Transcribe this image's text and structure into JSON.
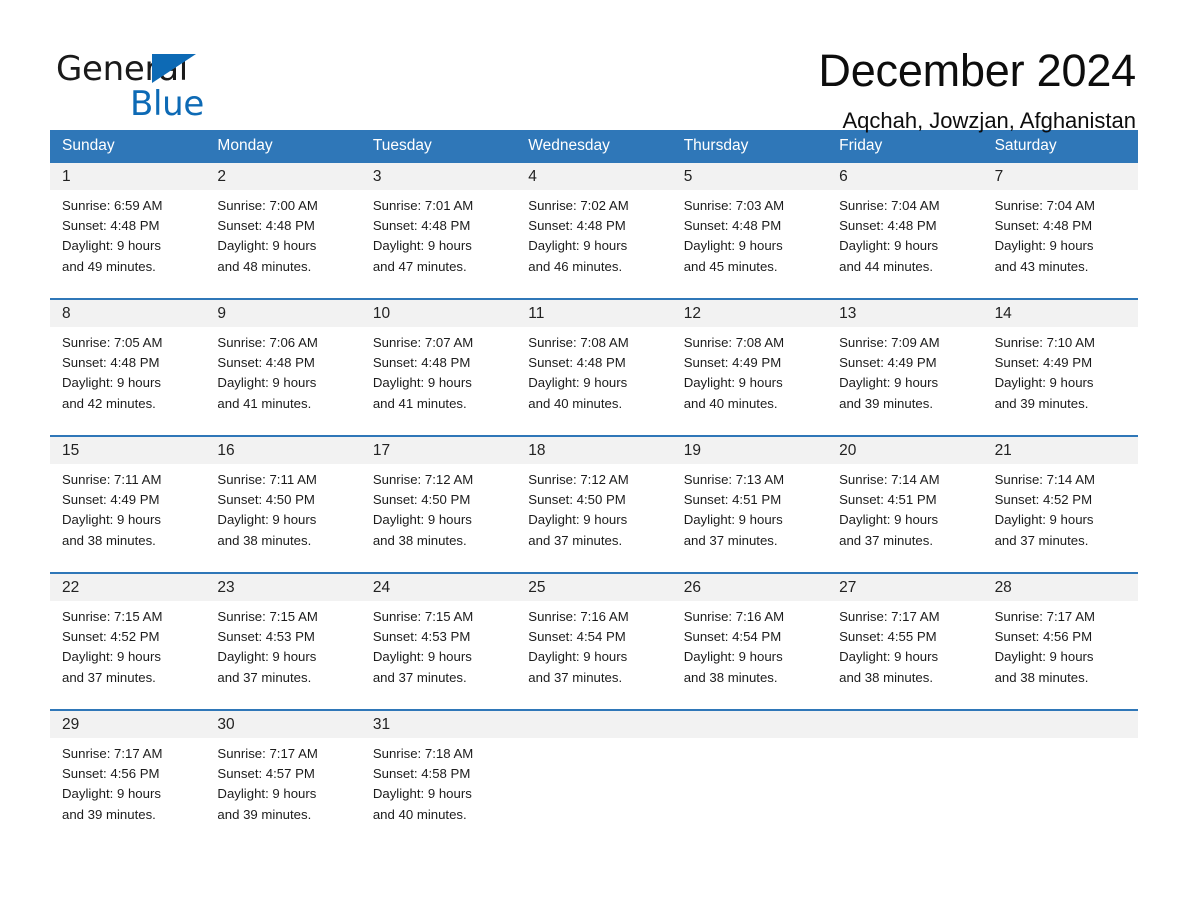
{
  "brand": {
    "name_part1": "General",
    "name_part2": "Blue",
    "accent_color": "#0d6ab5"
  },
  "header": {
    "title": "December 2024",
    "subtitle": "Aqchah, Jowzjan, Afghanistan"
  },
  "calendar": {
    "header_bg_color": "#2f77b8",
    "daynum_bg_color": "#f2f2f2",
    "weekdays": [
      "Sunday",
      "Monday",
      "Tuesday",
      "Wednesday",
      "Thursday",
      "Friday",
      "Saturday"
    ],
    "weeks": [
      {
        "days": [
          {
            "num": "1",
            "sunrise": "Sunrise: 6:59 AM",
            "sunset": "Sunset: 4:48 PM",
            "daylight1": "Daylight: 9 hours",
            "daylight2": "and 49 minutes."
          },
          {
            "num": "2",
            "sunrise": "Sunrise: 7:00 AM",
            "sunset": "Sunset: 4:48 PM",
            "daylight1": "Daylight: 9 hours",
            "daylight2": "and 48 minutes."
          },
          {
            "num": "3",
            "sunrise": "Sunrise: 7:01 AM",
            "sunset": "Sunset: 4:48 PM",
            "daylight1": "Daylight: 9 hours",
            "daylight2": "and 47 minutes."
          },
          {
            "num": "4",
            "sunrise": "Sunrise: 7:02 AM",
            "sunset": "Sunset: 4:48 PM",
            "daylight1": "Daylight: 9 hours",
            "daylight2": "and 46 minutes."
          },
          {
            "num": "5",
            "sunrise": "Sunrise: 7:03 AM",
            "sunset": "Sunset: 4:48 PM",
            "daylight1": "Daylight: 9 hours",
            "daylight2": "and 45 minutes."
          },
          {
            "num": "6",
            "sunrise": "Sunrise: 7:04 AM",
            "sunset": "Sunset: 4:48 PM",
            "daylight1": "Daylight: 9 hours",
            "daylight2": "and 44 minutes."
          },
          {
            "num": "7",
            "sunrise": "Sunrise: 7:04 AM",
            "sunset": "Sunset: 4:48 PM",
            "daylight1": "Daylight: 9 hours",
            "daylight2": "and 43 minutes."
          }
        ]
      },
      {
        "days": [
          {
            "num": "8",
            "sunrise": "Sunrise: 7:05 AM",
            "sunset": "Sunset: 4:48 PM",
            "daylight1": "Daylight: 9 hours",
            "daylight2": "and 42 minutes."
          },
          {
            "num": "9",
            "sunrise": "Sunrise: 7:06 AM",
            "sunset": "Sunset: 4:48 PM",
            "daylight1": "Daylight: 9 hours",
            "daylight2": "and 41 minutes."
          },
          {
            "num": "10",
            "sunrise": "Sunrise: 7:07 AM",
            "sunset": "Sunset: 4:48 PM",
            "daylight1": "Daylight: 9 hours",
            "daylight2": "and 41 minutes."
          },
          {
            "num": "11",
            "sunrise": "Sunrise: 7:08 AM",
            "sunset": "Sunset: 4:48 PM",
            "daylight1": "Daylight: 9 hours",
            "daylight2": "and 40 minutes."
          },
          {
            "num": "12",
            "sunrise": "Sunrise: 7:08 AM",
            "sunset": "Sunset: 4:49 PM",
            "daylight1": "Daylight: 9 hours",
            "daylight2": "and 40 minutes."
          },
          {
            "num": "13",
            "sunrise": "Sunrise: 7:09 AM",
            "sunset": "Sunset: 4:49 PM",
            "daylight1": "Daylight: 9 hours",
            "daylight2": "and 39 minutes."
          },
          {
            "num": "14",
            "sunrise": "Sunrise: 7:10 AM",
            "sunset": "Sunset: 4:49 PM",
            "daylight1": "Daylight: 9 hours",
            "daylight2": "and 39 minutes."
          }
        ]
      },
      {
        "days": [
          {
            "num": "15",
            "sunrise": "Sunrise: 7:11 AM",
            "sunset": "Sunset: 4:49 PM",
            "daylight1": "Daylight: 9 hours",
            "daylight2": "and 38 minutes."
          },
          {
            "num": "16",
            "sunrise": "Sunrise: 7:11 AM",
            "sunset": "Sunset: 4:50 PM",
            "daylight1": "Daylight: 9 hours",
            "daylight2": "and 38 minutes."
          },
          {
            "num": "17",
            "sunrise": "Sunrise: 7:12 AM",
            "sunset": "Sunset: 4:50 PM",
            "daylight1": "Daylight: 9 hours",
            "daylight2": "and 38 minutes."
          },
          {
            "num": "18",
            "sunrise": "Sunrise: 7:12 AM",
            "sunset": "Sunset: 4:50 PM",
            "daylight1": "Daylight: 9 hours",
            "daylight2": "and 37 minutes."
          },
          {
            "num": "19",
            "sunrise": "Sunrise: 7:13 AM",
            "sunset": "Sunset: 4:51 PM",
            "daylight1": "Daylight: 9 hours",
            "daylight2": "and 37 minutes."
          },
          {
            "num": "20",
            "sunrise": "Sunrise: 7:14 AM",
            "sunset": "Sunset: 4:51 PM",
            "daylight1": "Daylight: 9 hours",
            "daylight2": "and 37 minutes."
          },
          {
            "num": "21",
            "sunrise": "Sunrise: 7:14 AM",
            "sunset": "Sunset: 4:52 PM",
            "daylight1": "Daylight: 9 hours",
            "daylight2": "and 37 minutes."
          }
        ]
      },
      {
        "days": [
          {
            "num": "22",
            "sunrise": "Sunrise: 7:15 AM",
            "sunset": "Sunset: 4:52 PM",
            "daylight1": "Daylight: 9 hours",
            "daylight2": "and 37 minutes."
          },
          {
            "num": "23",
            "sunrise": "Sunrise: 7:15 AM",
            "sunset": "Sunset: 4:53 PM",
            "daylight1": "Daylight: 9 hours",
            "daylight2": "and 37 minutes."
          },
          {
            "num": "24",
            "sunrise": "Sunrise: 7:15 AM",
            "sunset": "Sunset: 4:53 PM",
            "daylight1": "Daylight: 9 hours",
            "daylight2": "and 37 minutes."
          },
          {
            "num": "25",
            "sunrise": "Sunrise: 7:16 AM",
            "sunset": "Sunset: 4:54 PM",
            "daylight1": "Daylight: 9 hours",
            "daylight2": "and 37 minutes."
          },
          {
            "num": "26",
            "sunrise": "Sunrise: 7:16 AM",
            "sunset": "Sunset: 4:54 PM",
            "daylight1": "Daylight: 9 hours",
            "daylight2": "and 38 minutes."
          },
          {
            "num": "27",
            "sunrise": "Sunrise: 7:17 AM",
            "sunset": "Sunset: 4:55 PM",
            "daylight1": "Daylight: 9 hours",
            "daylight2": "and 38 minutes."
          },
          {
            "num": "28",
            "sunrise": "Sunrise: 7:17 AM",
            "sunset": "Sunset: 4:56 PM",
            "daylight1": "Daylight: 9 hours",
            "daylight2": "and 38 minutes."
          }
        ]
      },
      {
        "days": [
          {
            "num": "29",
            "sunrise": "Sunrise: 7:17 AM",
            "sunset": "Sunset: 4:56 PM",
            "daylight1": "Daylight: 9 hours",
            "daylight2": "and 39 minutes."
          },
          {
            "num": "30",
            "sunrise": "Sunrise: 7:17 AM",
            "sunset": "Sunset: 4:57 PM",
            "daylight1": "Daylight: 9 hours",
            "daylight2": "and 39 minutes."
          },
          {
            "num": "31",
            "sunrise": "Sunrise: 7:18 AM",
            "sunset": "Sunset: 4:58 PM",
            "daylight1": "Daylight: 9 hours",
            "daylight2": "and 40 minutes."
          },
          {
            "num": "",
            "sunrise": "",
            "sunset": "",
            "daylight1": "",
            "daylight2": ""
          },
          {
            "num": "",
            "sunrise": "",
            "sunset": "",
            "daylight1": "",
            "daylight2": ""
          },
          {
            "num": "",
            "sunrise": "",
            "sunset": "",
            "daylight1": "",
            "daylight2": ""
          },
          {
            "num": "",
            "sunrise": "",
            "sunset": "",
            "daylight1": "",
            "daylight2": ""
          }
        ]
      }
    ]
  }
}
